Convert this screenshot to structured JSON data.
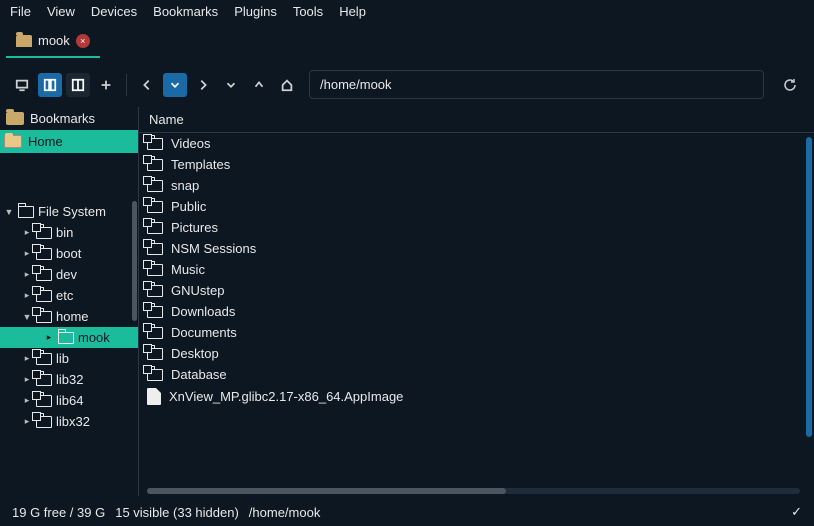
{
  "menu": [
    "File",
    "View",
    "Devices",
    "Bookmarks",
    "Plugins",
    "Tools",
    "Help"
  ],
  "tab": {
    "label": "mook"
  },
  "path": "/home/mook",
  "sidebar": {
    "bookmarks_label": "Bookmarks",
    "home_label": "Home",
    "fs_label": "File System",
    "tree": [
      {
        "label": "bin",
        "ind": 22
      },
      {
        "label": "boot",
        "ind": 22
      },
      {
        "label": "dev",
        "ind": 22
      },
      {
        "label": "etc",
        "ind": 22
      },
      {
        "label": "home",
        "ind": 22,
        "open": true
      },
      {
        "label": "mook",
        "ind": 44,
        "sel": true
      },
      {
        "label": "lib",
        "ind": 22
      },
      {
        "label": "lib32",
        "ind": 22
      },
      {
        "label": "lib64",
        "ind": 22
      },
      {
        "label": "libx32",
        "ind": 22
      }
    ]
  },
  "col_name": "Name",
  "files": [
    {
      "name": "Videos",
      "t": "d"
    },
    {
      "name": "Templates",
      "t": "d"
    },
    {
      "name": "snap",
      "t": "d"
    },
    {
      "name": "Public",
      "t": "d"
    },
    {
      "name": "Pictures",
      "t": "d"
    },
    {
      "name": "NSM Sessions",
      "t": "d"
    },
    {
      "name": "Music",
      "t": "d"
    },
    {
      "name": "GNUstep",
      "t": "d"
    },
    {
      "name": "Downloads",
      "t": "d"
    },
    {
      "name": "Documents",
      "t": "d"
    },
    {
      "name": "Desktop",
      "t": "d"
    },
    {
      "name": "Database",
      "t": "d"
    },
    {
      "name": "XnView_MP.glibc2.17-x86_64.AppImage",
      "t": "f"
    }
  ],
  "status": {
    "disk": "19 G free / 39 G",
    "vis": "15 visible (33 hidden)",
    "path": "/home/mook"
  }
}
